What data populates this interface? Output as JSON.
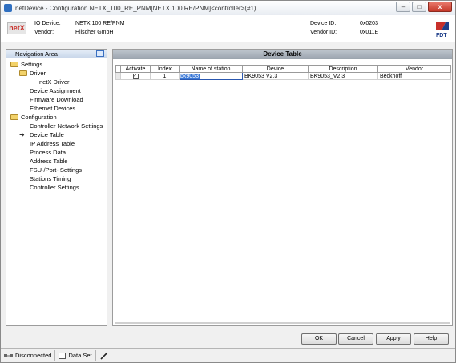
{
  "window": {
    "title": "netDevice - Configuration NETX_100_RE_PNM[NETX 100 RE/PNM]<controller>(#1)",
    "controls": {
      "minimize": "–",
      "maximize": "□",
      "close": "x"
    }
  },
  "header": {
    "logo_text": "netX",
    "io_device_label": "IO Device:",
    "io_device_value": "NETX 100 RE/PNM",
    "vendor_label": "Vendor:",
    "vendor_value": "Hilscher GmbH",
    "device_id_label": "Device ID:",
    "device_id_value": "0x0203",
    "vendor_id_label": "Vendor ID:",
    "vendor_id_value": "0x011E",
    "fdt_logo_text": "FDT"
  },
  "navigation": {
    "title": "Navigation Area",
    "items": [
      {
        "label": "Settings",
        "type": "folder",
        "level": 0
      },
      {
        "label": "Driver",
        "type": "folder",
        "level": 1
      },
      {
        "label": "netX Driver",
        "type": "leaf",
        "level": 2
      },
      {
        "label": "Device Assignment",
        "type": "leaf",
        "level": 1
      },
      {
        "label": "Firmware Download",
        "type": "leaf",
        "level": 1
      },
      {
        "label": "Ethernet Devices",
        "type": "leaf",
        "level": 1
      },
      {
        "label": "Configuration",
        "type": "folder",
        "level": 0
      },
      {
        "label": "Controller Network Settings",
        "type": "leaf",
        "level": 1
      },
      {
        "label": "Device Table",
        "type": "leaf",
        "level": 1,
        "selected": true
      },
      {
        "label": "IP Address Table",
        "type": "leaf",
        "level": 1
      },
      {
        "label": "Process Data",
        "type": "leaf",
        "level": 1
      },
      {
        "label": "Address Table",
        "type": "leaf",
        "level": 1
      },
      {
        "label": "FSU-/Port- Settings",
        "type": "leaf",
        "level": 1
      },
      {
        "label": "Stations Timing",
        "type": "leaf",
        "level": 1
      },
      {
        "label": "Controller Settings",
        "type": "leaf",
        "level": 1
      }
    ]
  },
  "device_table": {
    "title": "Device Table",
    "columns": [
      "Activate",
      "Index",
      "Name of station",
      "Device",
      "Description",
      "Vendor"
    ],
    "rows": [
      {
        "activate": true,
        "index": "1",
        "name_of_station": "bk9053",
        "device": "BK9053 V2.3",
        "description": "BK9053_V2.3",
        "vendor": "Beckhoff"
      }
    ]
  },
  "buttons": {
    "ok": "OK",
    "cancel": "Cancel",
    "apply": "Apply",
    "help": "Help"
  },
  "statusbar": {
    "connection": "Disconnected",
    "dataset": "Data Set"
  }
}
